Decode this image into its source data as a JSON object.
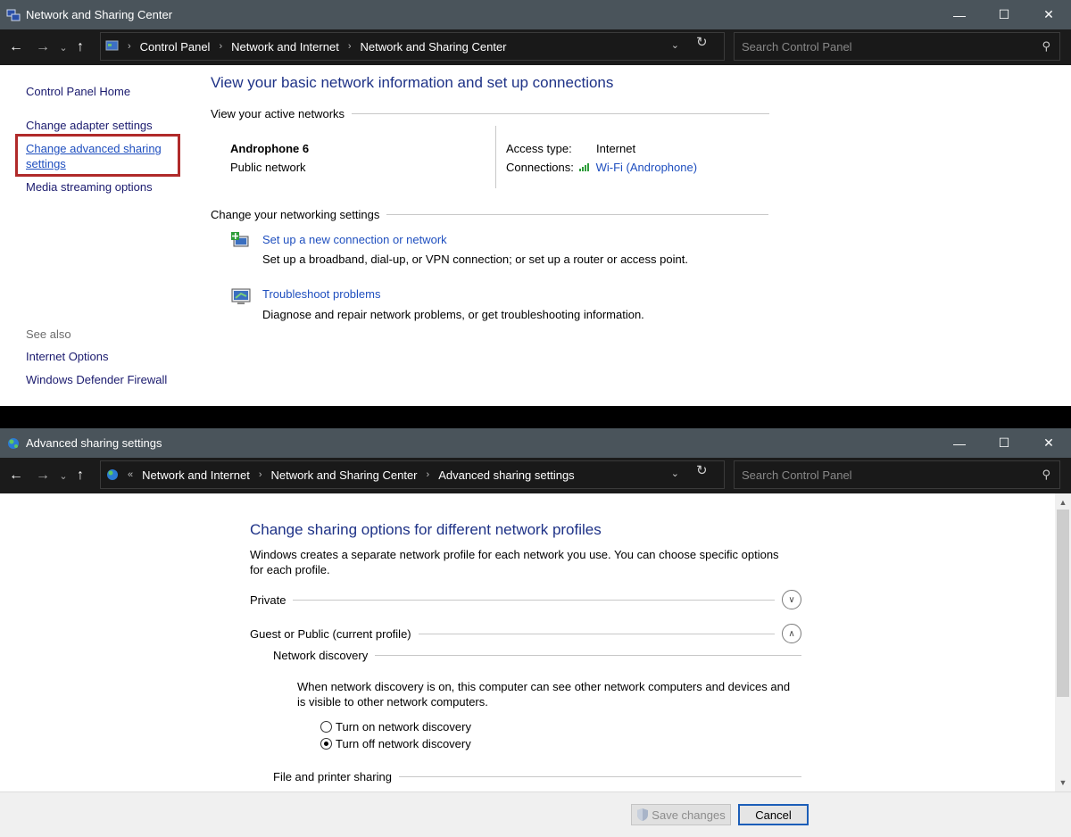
{
  "window1": {
    "title": "Network and Sharing Center",
    "breadcrumb": [
      "Control Panel",
      "Network and Internet",
      "Network and Sharing Center"
    ],
    "search_placeholder": "Search Control Panel",
    "sidebar": {
      "home": "Control Panel Home",
      "items": [
        "Change adapter settings",
        "Change advanced sharing",
        "settings",
        "Media streaming options"
      ],
      "see_also_label": "See also",
      "see_also": [
        "Internet Options",
        "Windows Defender Firewall"
      ]
    },
    "heading": "View your basic network information and set up connections",
    "active_networks_label": "View your active networks",
    "network": {
      "name": "Androphone 6",
      "type": "Public network",
      "access_type_label": "Access type:",
      "access_type": "Internet",
      "connections_label": "Connections:",
      "connection": "Wi-Fi (Androphone)"
    },
    "change_settings_label": "Change your networking settings",
    "tasks": [
      {
        "link": "Set up a new connection or network",
        "desc": "Set up a broadband, dial-up, or VPN connection; or set up a router or access point."
      },
      {
        "link": "Troubleshoot problems",
        "desc": "Diagnose and repair network problems, or get troubleshooting information."
      }
    ]
  },
  "window2": {
    "title": "Advanced sharing settings",
    "breadcrumb_prefix": "«",
    "breadcrumb": [
      "Network and Internet",
      "Network and Sharing Center",
      "Advanced sharing settings"
    ],
    "search_placeholder": "Search Control Panel",
    "heading": "Change sharing options for different network profiles",
    "description": "Windows creates a separate network profile for each network you use. You can choose specific options for each profile.",
    "profiles": {
      "private": "Private",
      "guest_public": "Guest or Public (current profile)"
    },
    "network_discovery": {
      "label": "Network discovery",
      "desc": "When network discovery is on, this computer can see other network computers and devices and is visible to other network computers.",
      "options": [
        "Turn on network discovery",
        "Turn off network discovery"
      ],
      "selected": "Turn off network discovery"
    },
    "file_printer_label": "File and printer sharing",
    "buttons": {
      "save": "Save changes",
      "cancel": "Cancel"
    }
  },
  "colors": {
    "titlebar": "#4a545b",
    "navbar": "#1b1b1b",
    "heading": "#1e3287",
    "link": "#1f4fbf",
    "highlight": "#b02a2a"
  }
}
